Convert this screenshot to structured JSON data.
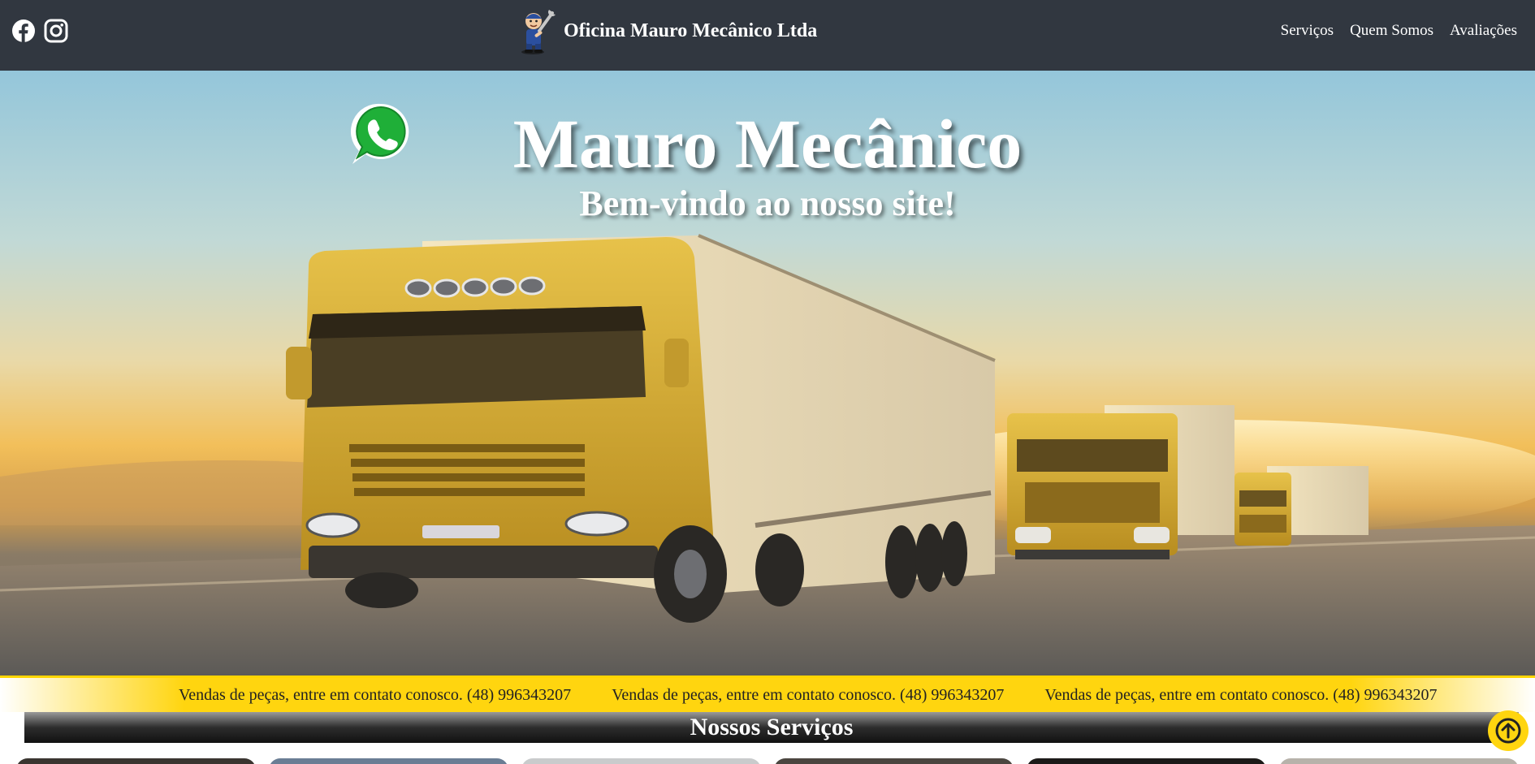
{
  "header": {
    "brand_title": "Oficina Mauro Mecânico Ltda",
    "nav": [
      "Serviços",
      "Quem Somos",
      "Avaliações"
    ],
    "social_icons": [
      "facebook-icon",
      "instagram-icon"
    ],
    "background": "#313740"
  },
  "hero": {
    "title": "Mauro Mecânico",
    "subtitle": "Bem-vindo ao nosso site!",
    "whatsapp_icon": "whatsapp-icon"
  },
  "ticker": {
    "messages": [
      "Vendas de peças, entre em contato conosco. (48) 996343207",
      "Vendas de peças, entre em contato conosco. (48) 996343207",
      "Vendas de peças, entre em contato conosco. (48) 996343207"
    ],
    "background": "#ffd50f"
  },
  "services": {
    "heading": "Nossos Serviços",
    "card_colors": [
      "#3a3530",
      "#6a7d94",
      "#c9cbcc",
      "#4b4640",
      "#1c1a18",
      "#b7b2aa"
    ]
  },
  "back_to_top": {
    "icon": "arrow-up-circle-icon",
    "color": "#ffd50f"
  }
}
